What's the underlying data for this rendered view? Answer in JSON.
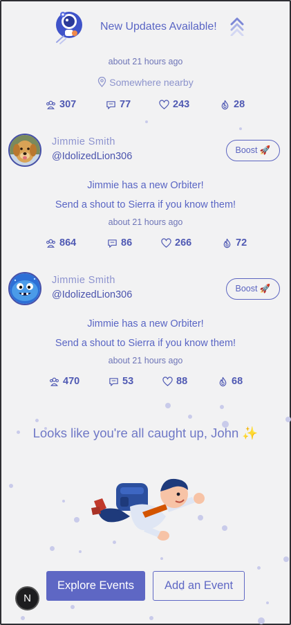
{
  "banner": {
    "text": "New Updates Available!",
    "mascot_icon": "astronaut-mascot",
    "action_icon": "double-chevron-up-icon"
  },
  "summary": {
    "timestamp": "about 21 hours ago",
    "location": "Somewhere nearby",
    "stats": {
      "people": "307",
      "comments": "77",
      "likes": "243",
      "boosts": "28"
    }
  },
  "feed": [
    {
      "name": "Jimmie Smith",
      "handle": "@IdolizedLion306",
      "avatar": "golden-retriever-avatar",
      "boost_label": "Boost 🚀",
      "line1": "Jimmie has a new Orbiter!",
      "line2": "Send a shout to Sierra if you know them!",
      "timestamp": "about 21 hours ago",
      "stats": {
        "people": "864",
        "comments": "86",
        "likes": "266",
        "boosts": "72"
      }
    },
    {
      "name": "Jimmie Smith",
      "handle": "@IdolizedLion306",
      "avatar": "blue-monster-avatar",
      "boost_label": "Boost 🚀",
      "line1": "Jimmie has a new Orbiter!",
      "line2": "Send a shout to Sierra if you know them!",
      "timestamp": "about 21 hours ago",
      "stats": {
        "people": "470",
        "comments": "53",
        "likes": "88",
        "boosts": "68"
      }
    }
  ],
  "caught_up": "Looks like you're all caught up, John ✨",
  "actions": {
    "explore": "Explore Events",
    "add": "Add an Event"
  },
  "dev_badge": "N",
  "colors": {
    "accent": "#5e67c4",
    "background": "#f2f2f3",
    "muted": "#8d93cf"
  }
}
